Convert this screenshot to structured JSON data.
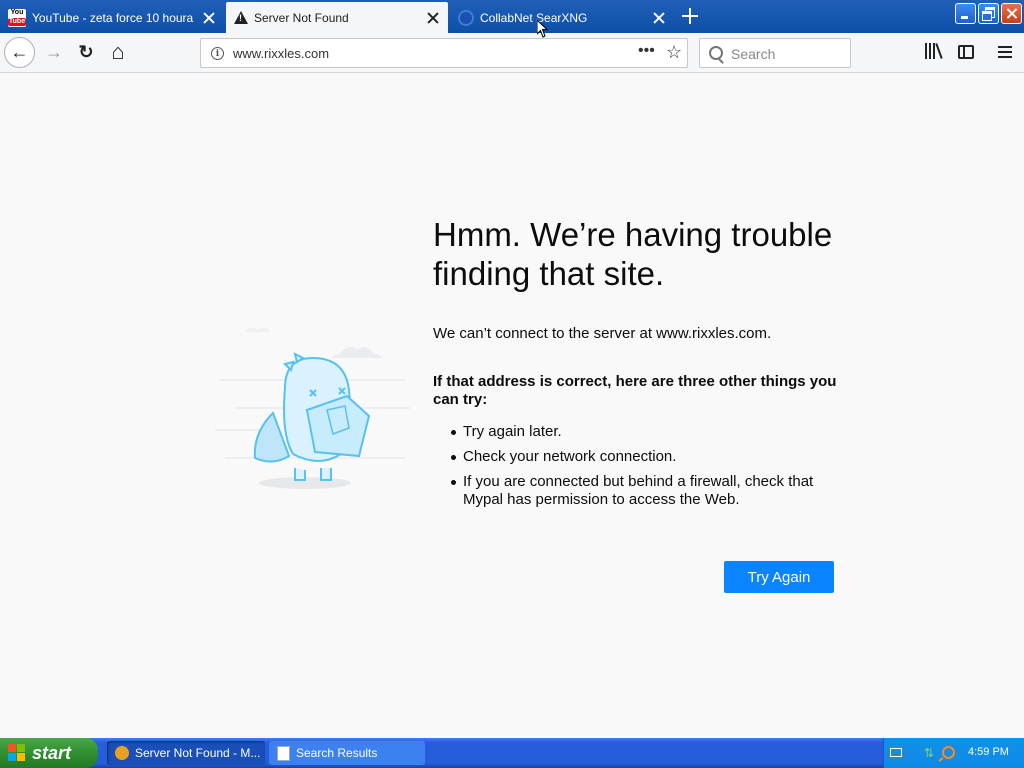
{
  "tabs": [
    {
      "title": "YouTube - zeta force 10 houra",
      "icon": "youtube-icon",
      "active": false
    },
    {
      "title": "Server Not Found",
      "icon": "warning-icon",
      "active": true
    },
    {
      "title": "CollabNet SearXNG",
      "icon": "searxng-icon",
      "active": false
    }
  ],
  "icon_labels": {
    "youtube_top": "You",
    "youtube_bottom": "Tube",
    "info": "i",
    "page_actions": "•••",
    "bookmark": "☆",
    "back": "←",
    "forward": "→",
    "reload": "↻",
    "home": "⌂"
  },
  "nav": {
    "url": "www.rixxles.com",
    "search_placeholder": "Search"
  },
  "error": {
    "title": "Hmm. We’re having trouble finding that site.",
    "description": "We can’t connect to the server at www.rixxles.com.",
    "suggestions_heading": "If that address is correct, here are three other things you can try:",
    "suggestions": [
      "Try again later.",
      "Check your network connection.",
      "If you are connected but behind a firewall, check that Mypal has permission to access the Web."
    ],
    "try_again_label": "Try Again"
  },
  "taskbar": {
    "start_label": "start",
    "tasks": [
      {
        "label": "Server Not Found - M...",
        "icon": "browser-icon",
        "active": true
      },
      {
        "label": "Search Results",
        "icon": "document-icon",
        "active": false
      }
    ],
    "clock": "4:59 PM"
  },
  "colors": {
    "accent": "#0a84ff",
    "tabstrip": "#1f5fb8",
    "taskbar": "#245edb",
    "start_green": "#2d8a2d"
  }
}
